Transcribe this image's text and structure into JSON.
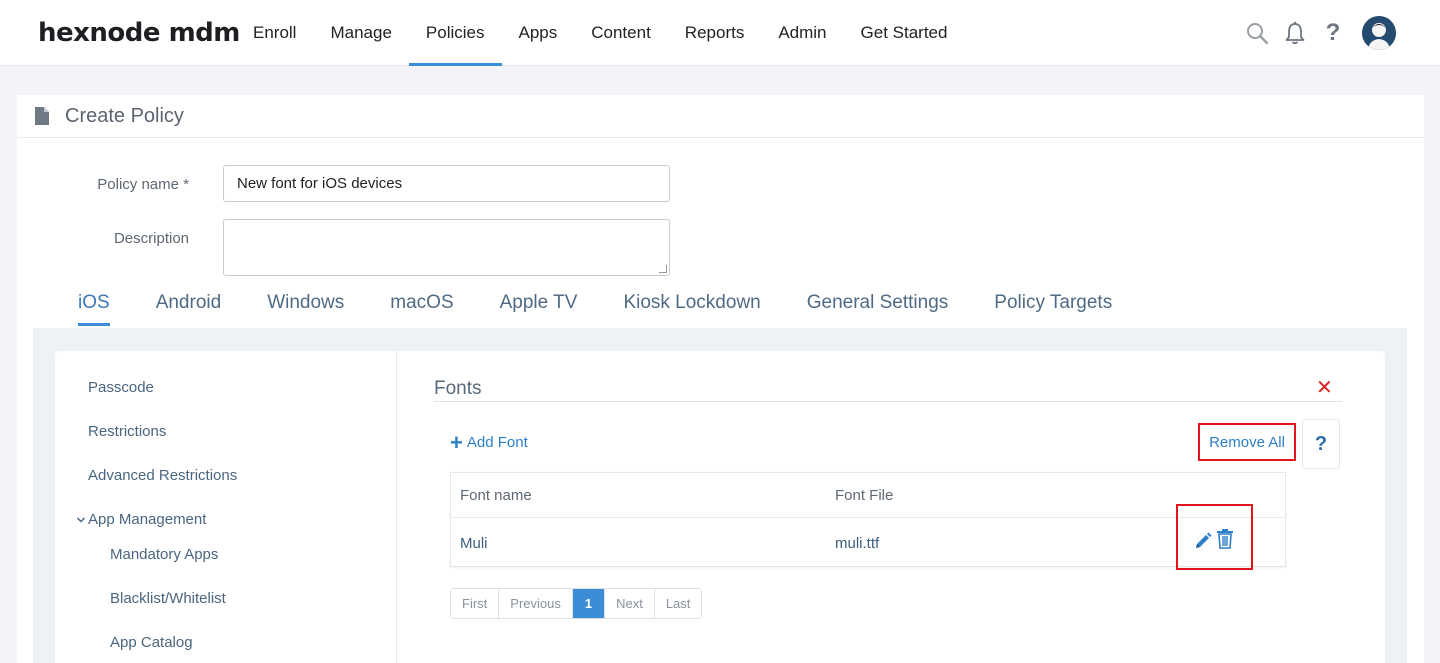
{
  "brand": {
    "logo": "hexnode mdm"
  },
  "nav": {
    "items": [
      "Enroll",
      "Manage",
      "Policies",
      "Apps",
      "Content",
      "Reports",
      "Admin",
      "Get Started"
    ],
    "active": "Policies"
  },
  "top_icons": [
    "search-icon",
    "bell-icon",
    "help-icon",
    "avatar"
  ],
  "page": {
    "title": "Create Policy"
  },
  "form": {
    "policy_name_label": "Policy name *",
    "policy_name_value": "New font for iOS devices",
    "description_label": "Description",
    "description_value": ""
  },
  "os_tabs": {
    "items": [
      "iOS",
      "Android",
      "Windows",
      "macOS",
      "Apple TV",
      "Kiosk Lockdown",
      "General Settings",
      "Policy Targets"
    ],
    "active": "iOS"
  },
  "sidebar": {
    "items": [
      "Passcode",
      "Restrictions",
      "Advanced Restrictions",
      "App Management"
    ],
    "sub_items": [
      "Mandatory Apps",
      "Blacklist/Whitelist",
      "App Catalog"
    ]
  },
  "fonts": {
    "section_title": "Fonts",
    "add_label": "Add Font",
    "remove_all_label": "Remove All",
    "help_label": "?",
    "columns": [
      "Font name",
      "Font File"
    ],
    "rows": [
      {
        "name": "Muli",
        "file": "muli.ttf"
      }
    ]
  },
  "pagination": {
    "first": "First",
    "previous": "Previous",
    "current": "1",
    "next": "Next",
    "last": "Last"
  },
  "colors": {
    "accent": "#3b8ed6",
    "highlight": "#e0161c",
    "close": "#e02020"
  }
}
